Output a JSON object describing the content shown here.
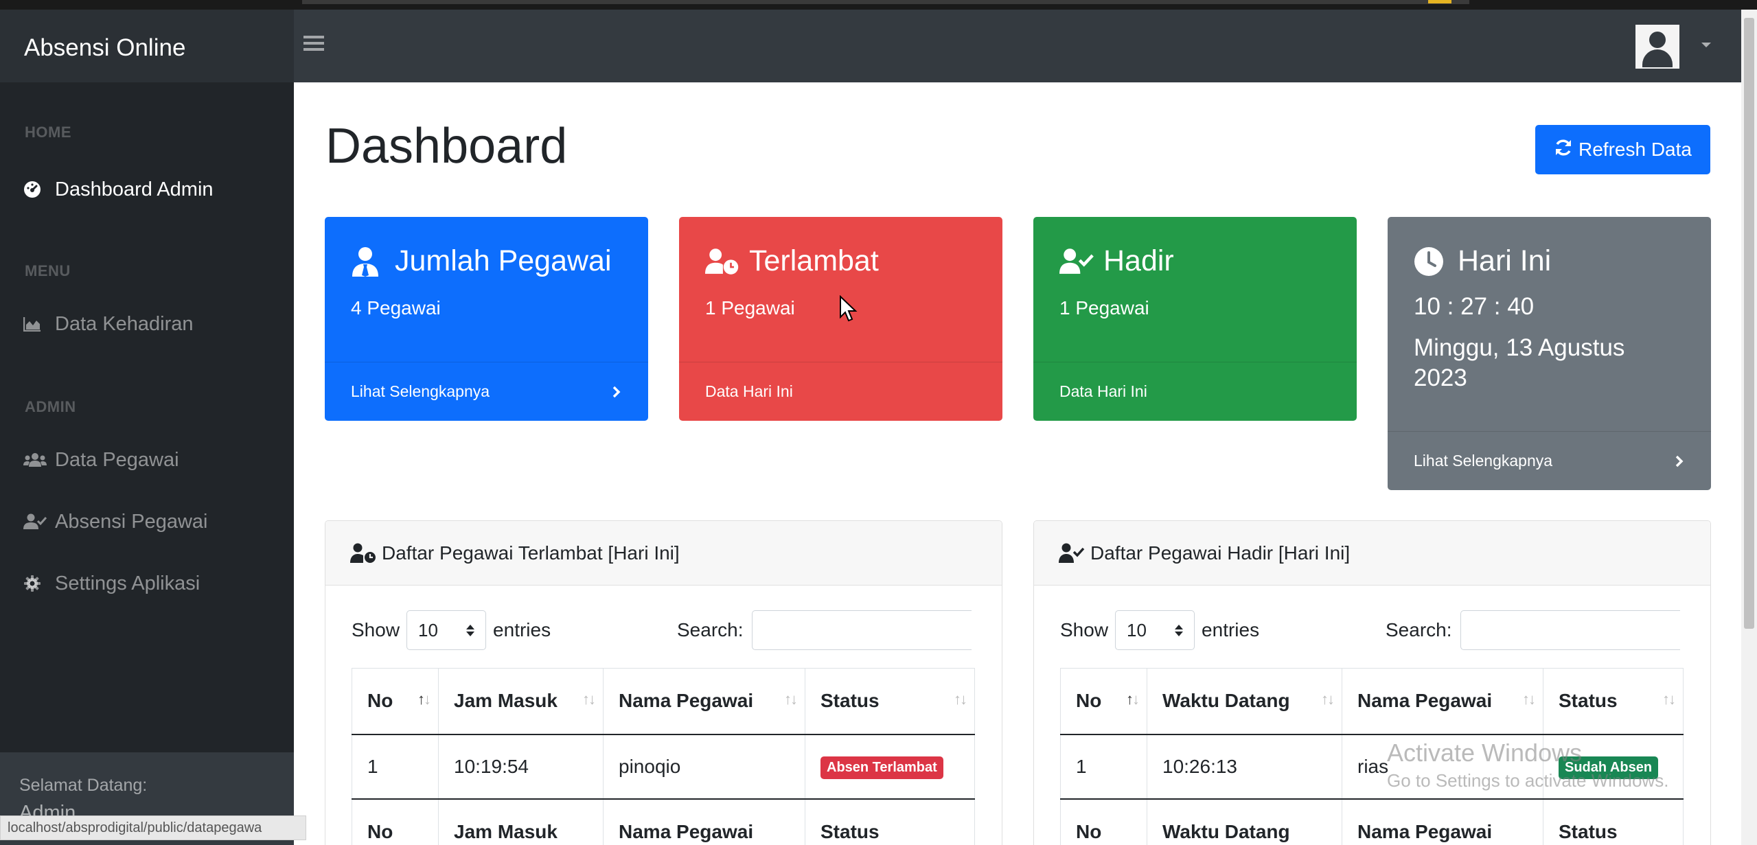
{
  "app": {
    "brand": "Absensi Online",
    "status_url": "localhost/absprodigital/public/datapegawa"
  },
  "sidebar": {
    "sections": {
      "home": "HOME",
      "menu": "MENU",
      "admin": "ADMIN"
    },
    "items": [
      {
        "label": "Dashboard Admin",
        "icon": "gauge-icon"
      },
      {
        "label": "Data Kehadiran",
        "icon": "area-chart-icon"
      },
      {
        "label": "Data Pegawai",
        "icon": "users-icon"
      },
      {
        "label": "Absensi Pegawai",
        "icon": "user-check-icon"
      },
      {
        "label": "Settings Aplikasi",
        "icon": "gear-icon"
      }
    ],
    "footer": {
      "greeting": "Selamat Datang:",
      "user": "Admin"
    }
  },
  "main": {
    "title": "Dashboard",
    "refresh_label": "Refresh Data",
    "cards": [
      {
        "title": "Jumlah Pegawai",
        "value": "4 Pegawai",
        "footer": "Lihat Selengkapnya",
        "color": "#0d6efd"
      },
      {
        "title": "Terlambat",
        "value": "1 Pegawai",
        "footer": "Data Hari Ini",
        "color": "#e84848"
      },
      {
        "title": "Hadir",
        "value": "1 Pegawai",
        "footer": "Data Hari Ini",
        "color": "#239a48"
      },
      {
        "title": "Hari Ini",
        "time": "10 : 27 : 40",
        "date": "Minggu, 13 Agustus 2023",
        "footer": "Lihat Selengkapnya",
        "color": "#6c757d"
      }
    ]
  },
  "late_table": {
    "title": "Daftar Pegawai Terlambat [Hari Ini]",
    "show": "Show",
    "entries_value": "10",
    "entries": "entries",
    "search": "Search:",
    "headers": [
      "No",
      "Jam Masuk",
      "Nama Pegawai",
      "Status"
    ],
    "rows": [
      {
        "no": "1",
        "time": "10:19:54",
        "name": "pinoqio",
        "status": "Absen Terlambat",
        "status_color": "#dc3545"
      }
    ]
  },
  "present_table": {
    "title": "Daftar Pegawai Hadir [Hari Ini]",
    "show": "Show",
    "entries_value": "10",
    "entries": "entries",
    "search": "Search:",
    "headers": [
      "No",
      "Waktu Datang",
      "Nama Pegawai",
      "Status"
    ],
    "rows": [
      {
        "no": "1",
        "time": "10:26:13",
        "name": "rias",
        "status": "Sudah Absen",
        "status_color": "#198754"
      }
    ]
  },
  "watermark": {
    "line1": "Activate Windows",
    "line2": "Go to Settings to activate Windows."
  }
}
